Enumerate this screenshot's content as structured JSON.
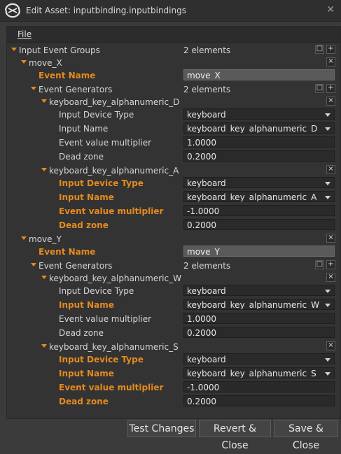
{
  "window": {
    "title": "Edit Asset: inputbinding.inputbindings",
    "close_glyph": "✕",
    "logo_icon": "engine-logo-icon"
  },
  "menu": {
    "file": "File"
  },
  "tree": {
    "groups_label": "Input Event Groups",
    "groups_count": "2 elements",
    "groups": [
      {
        "name": "move_X",
        "event_name_label": "Event Name",
        "event_name_value": "move_X",
        "generators_label": "Event Generators",
        "generators_count": "2 elements",
        "generators": [
          {
            "name": "keyboard_key_alphanumeric_D",
            "device_type_label": "Input Device Type",
            "device_type_value": "keyboard",
            "input_name_label": "Input Name",
            "input_name_value": "keyboard_key_alphanumeric_D",
            "multiplier_label": "Event value multiplier",
            "multiplier_value": "1.0000",
            "dead_zone_label": "Dead zone",
            "dead_zone_value": "0.2000"
          },
          {
            "name": "keyboard_key_alphanumeric_A",
            "device_type_label": "Input Device Type",
            "device_type_value": "keyboard",
            "input_name_label": "Input Name",
            "input_name_value": "keyboard_key_alphanumeric_A",
            "multiplier_label": "Event value multiplier",
            "multiplier_value": "-1.0000",
            "dead_zone_label": "Dead zone",
            "dead_zone_value": "0.2000"
          }
        ]
      },
      {
        "name": "move_Y",
        "event_name_label": "Event Name",
        "event_name_value": "move_Y",
        "generators_label": "Event Generators",
        "generators_count": "2 elements",
        "generators": [
          {
            "name": "keyboard_key_alphanumeric_W",
            "device_type_label": "Input Device Type",
            "device_type_value": "keyboard",
            "input_name_label": "Input Name",
            "input_name_value": "keyboard_key_alphanumeric_W",
            "multiplier_label": "Event value multiplier",
            "multiplier_value": "1.0000",
            "dead_zone_label": "Dead zone",
            "dead_zone_value": "0.2000"
          },
          {
            "name": "keyboard_key_alphanumeric_S",
            "device_type_label": "Input Device Type",
            "device_type_value": "keyboard",
            "input_name_label": "Input Name",
            "input_name_value": "keyboard_key_alphanumeric_S",
            "multiplier_label": "Event value multiplier",
            "multiplier_value": "-1.0000",
            "dead_zone_label": "Dead zone",
            "dead_zone_value": "0.2000"
          }
        ]
      }
    ]
  },
  "buttons": {
    "add": "+",
    "clear": "□",
    "remove": "×",
    "test": "Test Changes",
    "revert": "Revert & Close",
    "save": "Save & Close"
  },
  "colors": {
    "accent": "#e48a1f",
    "background": "#333333",
    "field": "#2a2a2a"
  }
}
